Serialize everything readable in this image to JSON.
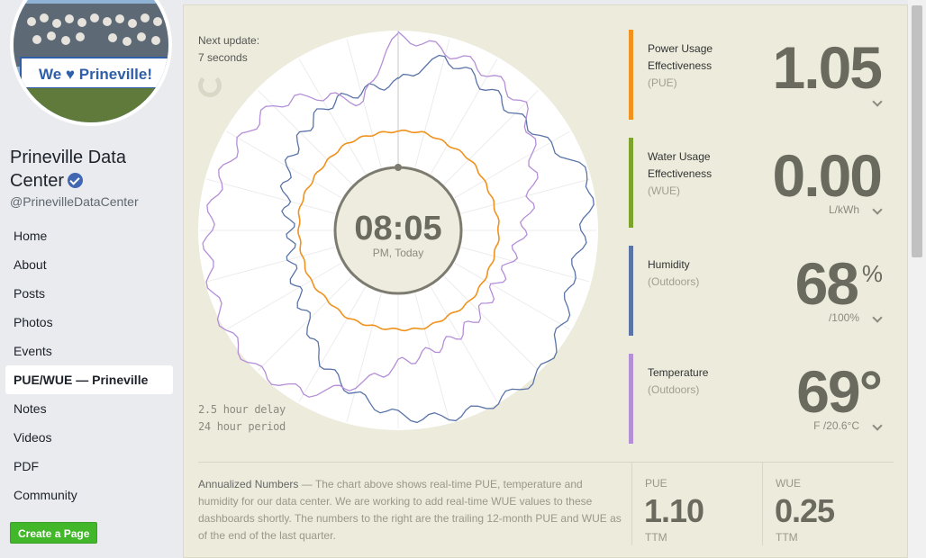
{
  "sidebar": {
    "page_name": "Prineville Data Center",
    "handle": "@PrinevilleDataCenter",
    "banner_text": "We ♥ Prineville!",
    "nav": [
      "Home",
      "About",
      "Posts",
      "Photos",
      "Events",
      "PUE/WUE — Prineville",
      "Notes",
      "Videos",
      "PDF",
      "Community"
    ],
    "active_nav": "PUE/WUE — Prineville",
    "create_button": "Create a Page"
  },
  "dashboard": {
    "next_update_label": "Next update:",
    "next_update_value": "7 seconds",
    "delay_line1": "2.5 hour delay",
    "delay_line2": "24 hour period",
    "clock_time": "08:05",
    "clock_sub": "PM, Today"
  },
  "metrics": [
    {
      "line1": "Power Usage",
      "line2": "Effectiveness",
      "abbr": "(PUE)",
      "value": "1.05",
      "value_unit": "",
      "unit": "",
      "color": "#f0921e"
    },
    {
      "line1": "Water Usage",
      "line2": "Effectiveness",
      "abbr": "(WUE)",
      "value": "0.00",
      "value_unit": "",
      "unit": "L/kWh",
      "color": "#7ca32b"
    },
    {
      "line1": "Humidity",
      "line2": "(Outdoors)",
      "abbr": "",
      "value": "68",
      "value_unit": "%",
      "unit": "/100%",
      "color": "#5a74a8"
    },
    {
      "line1": "Temperature",
      "line2": "(Outdoors)",
      "abbr": "",
      "value": "69°",
      "value_unit": "",
      "unit": "F /20.6°C",
      "color": "#b48ed6"
    }
  ],
  "annualized": {
    "heading": "Annualized Numbers",
    "text": " — The chart above shows real-time PUE, temperature and humidity for our data center. We are working to add real-time WUE values to these dashboards shortly. The numbers to the right are the trailing 12-month PUE and WUE as of the end of the last quarter.",
    "pue_label": "PUE",
    "pue_value": "1.10",
    "pue_sub": "TTM",
    "wue_label": "WUE",
    "wue_value": "0.25",
    "wue_sub": "TTM"
  },
  "colors": {
    "pue": "#f0921e",
    "wue": "#7ca32b",
    "humidity": "#5a74a8",
    "temperature": "#b48ed6",
    "panel_bg": "#ecebdc"
  },
  "chart_data": {
    "type": "radial-line",
    "period_hours": 24,
    "current_time": "08:05 PM",
    "series": [
      {
        "color": "#f0921e",
        "values": [
          1.05,
          1.06,
          1.05,
          1.06,
          1.05,
          1.05,
          1.06,
          1.05,
          1.05,
          1.06,
          1.05,
          1.06,
          1.05,
          1.05,
          1.06,
          1.05,
          1.06,
          1.05,
          1.05,
          1.06,
          1.05,
          1.05,
          1.06,
          1.05
        ]
      },
      {
        "color": "#5a74a8",
        "values": [
          70,
          85,
          80,
          78,
          82,
          95,
          88,
          85,
          90,
          96,
          94,
          92,
          88,
          80,
          72,
          60,
          55,
          52,
          50,
          55,
          60,
          64,
          68,
          68
        ]
      },
      {
        "color": "#b48ed6",
        "values": [
          98,
          94,
          92,
          90,
          80,
          72,
          66,
          62,
          60,
          62,
          64,
          66,
          70,
          82,
          95,
          100,
          100,
          98,
          96,
          94,
          92,
          90,
          80,
          69
        ]
      }
    ]
  }
}
